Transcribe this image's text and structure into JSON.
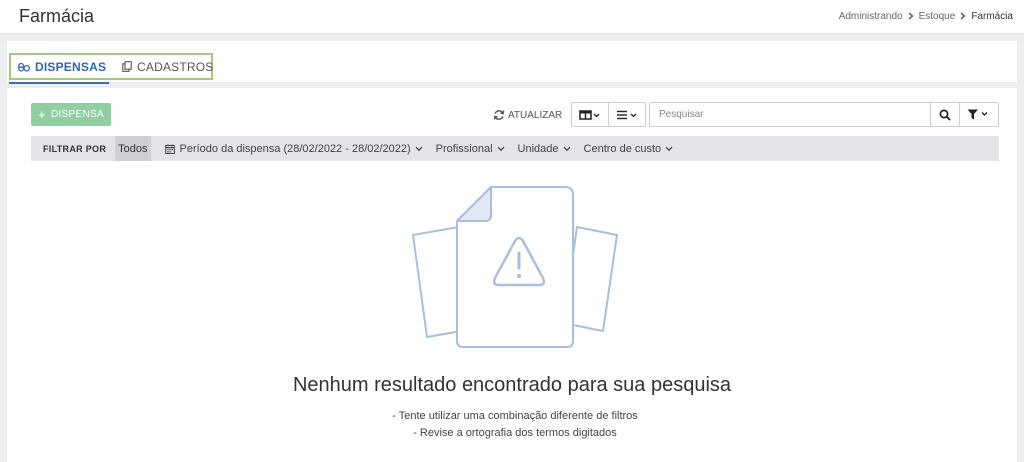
{
  "page": {
    "title": "Farmácia",
    "breadcrumb": [
      "Administrando",
      "Estoque",
      "Farmácia"
    ]
  },
  "tabs": [
    {
      "label": "DISPENSAS",
      "active": true,
      "icon": "pills-icon"
    },
    {
      "label": "CADASTROS",
      "active": false,
      "icon": "copy-icon"
    }
  ],
  "toolbar": {
    "add_label": "DISPENSA",
    "refresh_label": "ATUALIZAR",
    "search_placeholder": "Pesquisar",
    "search_value": ""
  },
  "filters": {
    "label": "FILTRAR POR",
    "all": "Todos",
    "items": [
      {
        "label": "Período da dispensa (28/02/2022 - 28/02/2022)",
        "icon": "calendar-icon"
      },
      {
        "label": "Profissional"
      },
      {
        "label": "Unidade"
      },
      {
        "label": "Centro de custo"
      }
    ]
  },
  "empty_state": {
    "title": "Nenhum resultado encontrado para sua pesquisa",
    "hints": [
      "- Tente utilizar uma combinação diferente de filtros",
      "- Revise a ortografia dos termos digitados"
    ]
  },
  "colors": {
    "accent": "#2f66b3",
    "add_button": "#8fcfa1",
    "tab_highlight_border": "#a5c87d",
    "illustration_stroke": "#a9bfe0"
  }
}
